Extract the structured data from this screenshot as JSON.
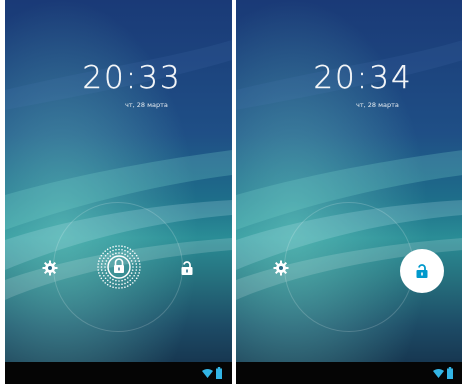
{
  "screens": [
    {
      "time": "20:33",
      "date": "чт, 28 марта",
      "state": "handle-grabbed"
    },
    {
      "time": "20:34",
      "date": "чт, 28 марта",
      "state": "unlock-selected"
    }
  ],
  "icons": {
    "settings": "gear-icon",
    "unlock": "unlock-icon",
    "lock_handle": "lock-icon",
    "wifi": "wifi-icon",
    "battery": "battery-icon"
  },
  "colors": {
    "accent": "#33b5e5",
    "unlock_selected": "#0099cc",
    "navbar": "#050505"
  }
}
